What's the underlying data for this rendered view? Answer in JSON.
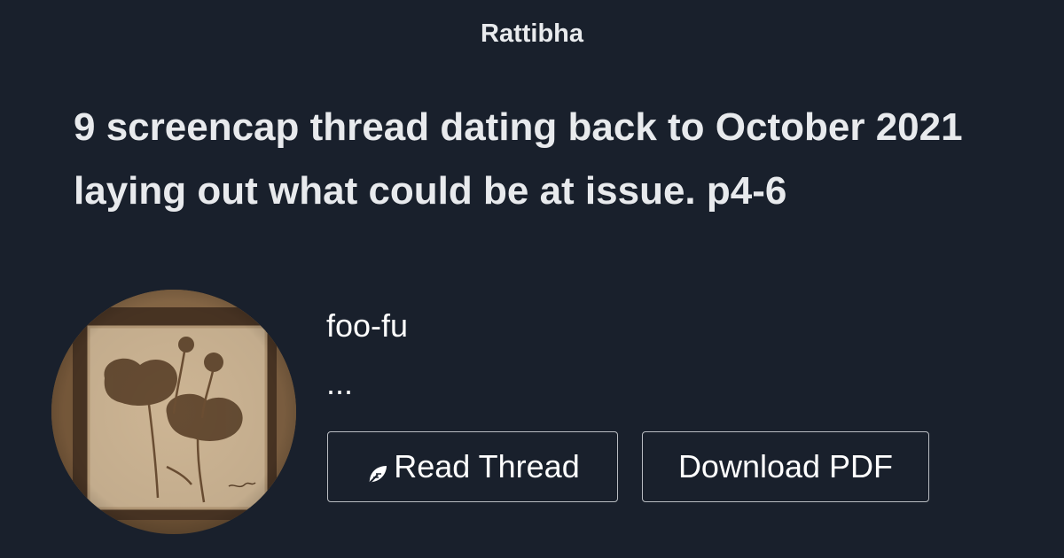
{
  "site": {
    "name": "Rattibha"
  },
  "thread": {
    "title": "9 screencap thread dating back to October 2021 laying out what could be at issue. p4-6"
  },
  "author": {
    "name": "foo-fu",
    "bio": "..."
  },
  "actions": {
    "read_label": "Read Thread",
    "read_icon": "feather-icon",
    "download_label": "Download PDF"
  },
  "colors": {
    "background": "#19202c",
    "text": "#e8eaed",
    "button_border": "#b9bcc2"
  }
}
